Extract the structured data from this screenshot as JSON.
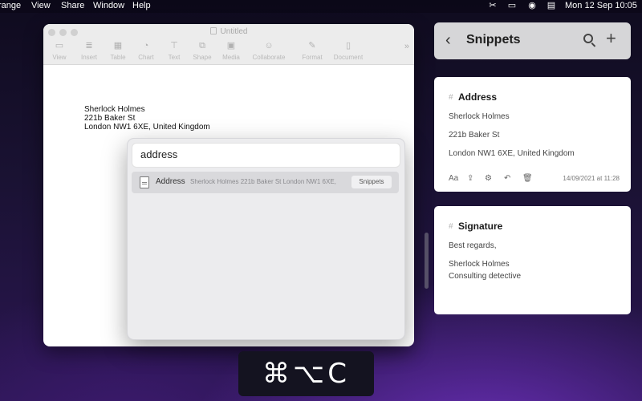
{
  "menubar": {
    "items": [
      "range",
      "View",
      "Share",
      "Window",
      "Help"
    ],
    "clock": "Mon 12 Sep  10:05"
  },
  "pages_window": {
    "title": "Untitled",
    "toolbar": [
      "View",
      "Insert",
      "Table",
      "Chart",
      "Text",
      "Shape",
      "Media",
      "Collaborate",
      "Format",
      "Document"
    ],
    "document_lines": [
      "Sherlock Holmes",
      "221b Baker St",
      "London NW1 6XE, United Kingdom"
    ]
  },
  "popup": {
    "search_value": "address",
    "result": {
      "name": "Address",
      "preview": "Sherlock Holmes 221b Baker St London NW1 6XE,",
      "tag": "Snippets"
    }
  },
  "snippets": {
    "header_title": "Snippets",
    "cards": [
      {
        "title": "Address",
        "lines": [
          "Sherlock Holmes",
          "221b Baker St",
          "London NW1 6XE, United Kingdom"
        ],
        "date": "14/09/2021 at 11:28"
      },
      {
        "title": "Signature",
        "lines": [
          "Best regards,",
          "Sherlock Holmes",
          "Consulting detective"
        ]
      }
    ]
  },
  "shortcut_hud": "⌘⌥C"
}
